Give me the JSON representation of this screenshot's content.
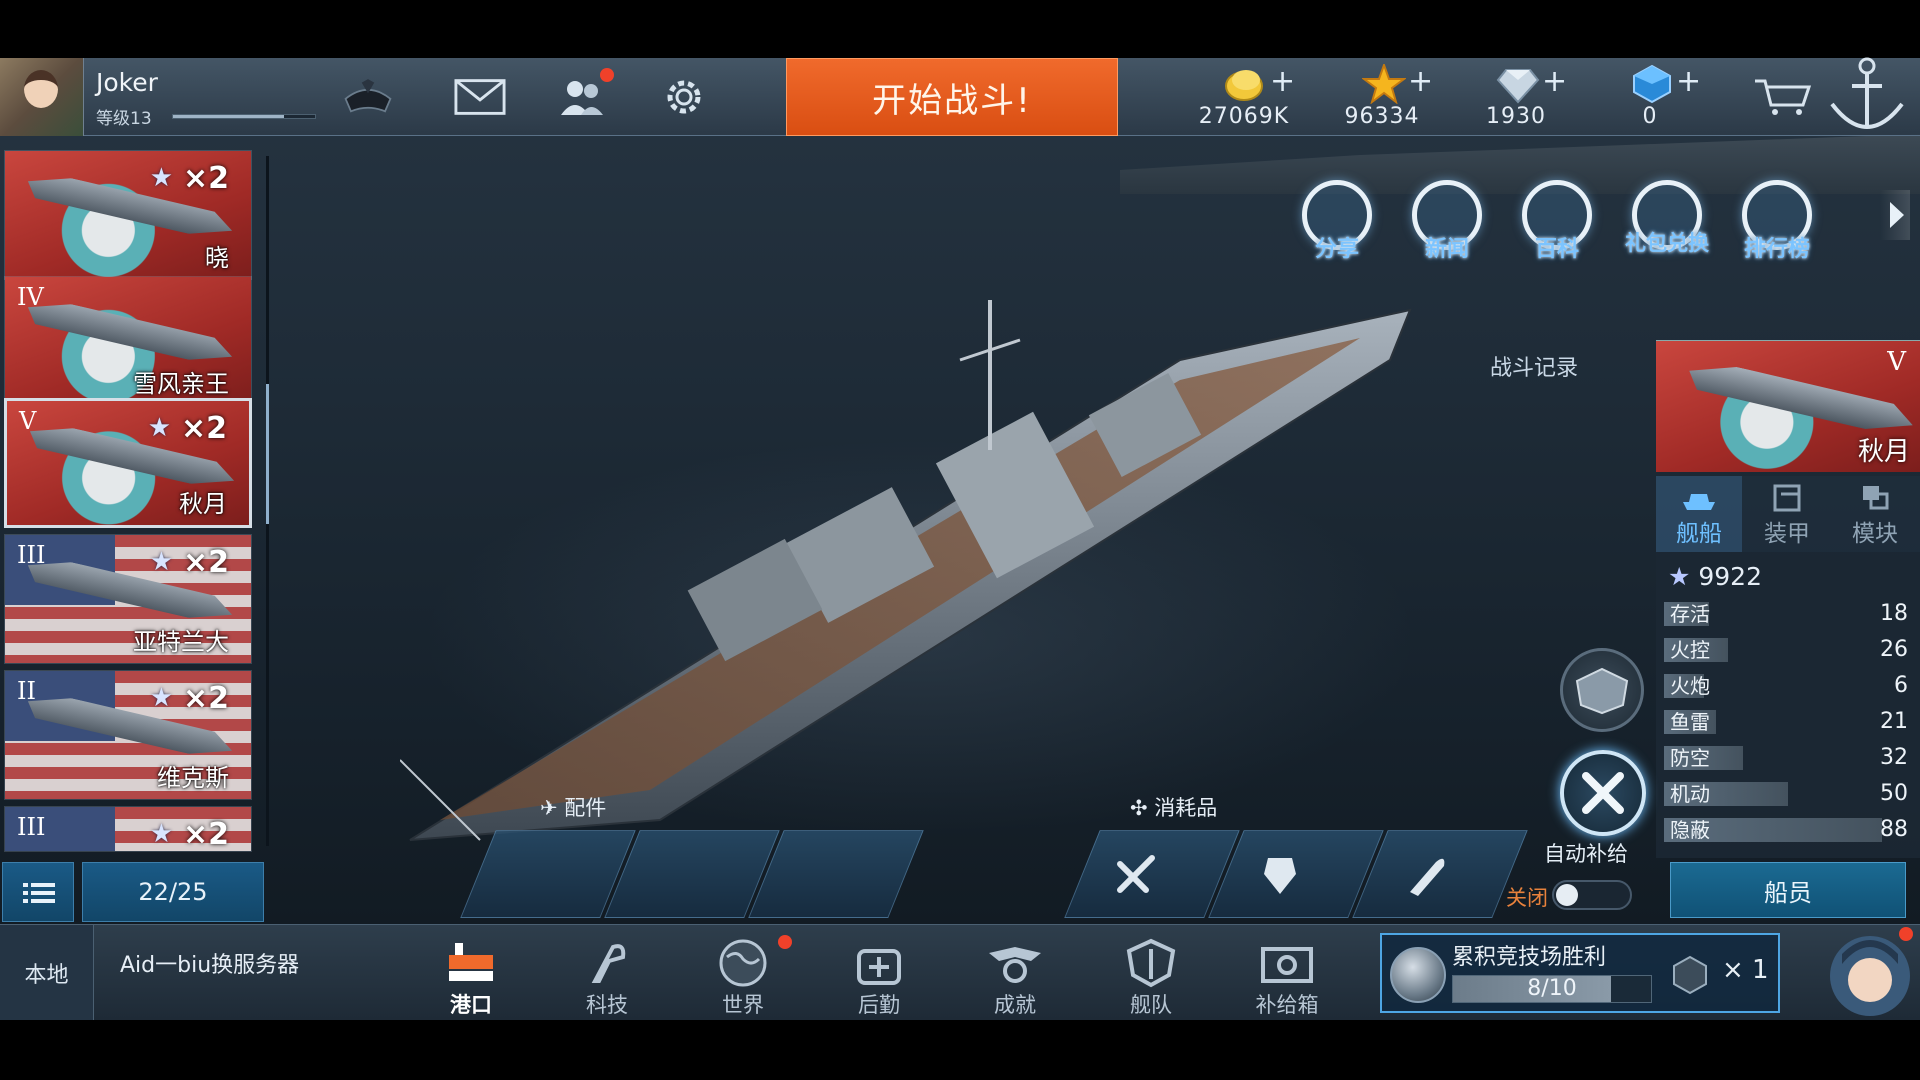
{
  "player": {
    "name": "Joker",
    "level": "等级13",
    "xp_fraction": 0.78
  },
  "start_battle_label": "开始战斗!",
  "resources": [
    {
      "icon": "gold-coin-icon",
      "value": "27069K",
      "plus": "+"
    },
    {
      "icon": "star-icon",
      "value": "96334",
      "plus": "+"
    },
    {
      "icon": "diamond-icon",
      "value": "1930",
      "plus": "+"
    },
    {
      "icon": "crystal-icon",
      "value": "0",
      "plus": "+"
    }
  ],
  "quick_menu": [
    {
      "icon": "share-icon",
      "label": "分享"
    },
    {
      "icon": "news-icon",
      "label": "新闻"
    },
    {
      "icon": "encyclopedia-icon",
      "label": "百科"
    },
    {
      "icon": "gift-exchange-icon",
      "label": "礼包兑换"
    },
    {
      "icon": "leaderboard-icon",
      "label": "排行榜"
    }
  ],
  "ships": [
    {
      "name": "晓",
      "tier": "",
      "mult": "×2",
      "flag": "jp"
    },
    {
      "name": "雪风亲王",
      "tier": "IV",
      "mult": "",
      "flag": "jp"
    },
    {
      "name": "秋月",
      "tier": "V",
      "mult": "×2",
      "flag": "jp",
      "selected": true
    },
    {
      "name": "亚特兰大",
      "tier": "III",
      "mult": "×2",
      "flag": "us"
    },
    {
      "name": "维克斯",
      "tier": "II",
      "mult": "×2",
      "flag": "us"
    },
    {
      "name": "",
      "tier": "III",
      "mult": "×2",
      "flag": "us"
    }
  ],
  "ship_count": "22/25",
  "battle_log_label": "战斗记录",
  "selected_ship": {
    "name": "秋月",
    "tier": "V",
    "tabs": [
      {
        "label": "舰船",
        "active": true
      },
      {
        "label": "装甲",
        "active": false
      },
      {
        "label": "模块",
        "active": false
      }
    ],
    "power": "9922",
    "stats": [
      {
        "label": "存活",
        "value": "18"
      },
      {
        "label": "火控",
        "value": "26"
      },
      {
        "label": "火炮",
        "value": "6"
      },
      {
        "label": "鱼雷",
        "value": "21"
      },
      {
        "label": "防空",
        "value": "32"
      },
      {
        "label": "机动",
        "value": "50"
      },
      {
        "label": "隐蔽",
        "value": "88"
      }
    ],
    "crew_label": "船员"
  },
  "parts_label": "配件",
  "consumables_label": "消耗品",
  "auto_supply_label": "自动补给",
  "auto_supply_state": "关闭",
  "bottom": {
    "local_label": "本地",
    "server_text": "Aid一biu换服务器",
    "nav": [
      {
        "icon": "harbor-icon",
        "label": "港口",
        "active": true
      },
      {
        "icon": "tech-icon",
        "label": "科技",
        "active": false
      },
      {
        "icon": "world-icon",
        "label": "世界",
        "active": false,
        "badge": true
      },
      {
        "icon": "logistics-icon",
        "label": "后勤",
        "active": false
      },
      {
        "icon": "achievement-icon",
        "label": "成就",
        "active": false
      },
      {
        "icon": "fleet-icon",
        "label": "舰队",
        "active": false
      },
      {
        "icon": "supply-box-icon",
        "label": "补给箱",
        "active": false
      }
    ],
    "arena": {
      "title": "累积竞技场胜利",
      "progress": "8/10",
      "progress_fraction": 0.8,
      "reward_mult": "× 1"
    }
  }
}
